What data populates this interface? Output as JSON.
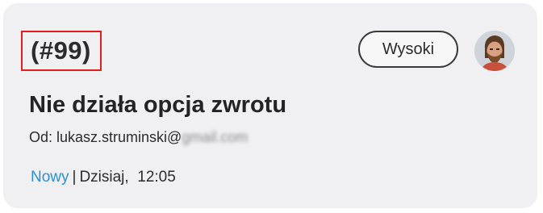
{
  "ticket": {
    "id": "(#99)",
    "priority": "Wysoki",
    "subject": "Nie działa opcja zwrotu",
    "from_prefix": "Od: lukasz.struminski@",
    "from_domain_obscured": "gmail.com",
    "status": "Nowy",
    "separator": "|",
    "date": "Dzisiaj,",
    "time": "12:05"
  },
  "colors": {
    "card_bg": "#f0f0f2",
    "highlight_border": "#e0201f",
    "status_link": "#2d8fd6"
  },
  "icons": {
    "avatar": "user-avatar-photo"
  }
}
